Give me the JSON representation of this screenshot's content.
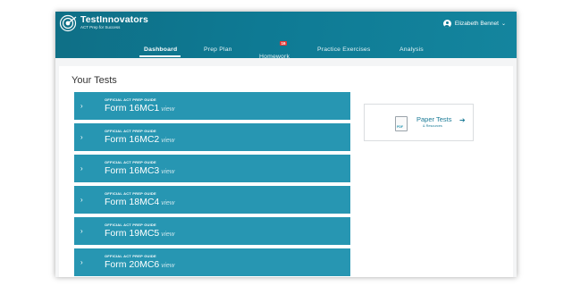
{
  "brand": {
    "name": "TestInnovators",
    "tagline": "ACT Prep for Success"
  },
  "user": {
    "name": "Elizabeth Bennet",
    "caret": "⌄"
  },
  "nav": {
    "items": [
      {
        "label": "Dashboard"
      },
      {
        "label": "Prep Plan"
      },
      {
        "label": "Homework",
        "badge": "16"
      },
      {
        "label": "Practice Exercises"
      },
      {
        "label": "Analysis"
      }
    ],
    "active": "Dashboard"
  },
  "main": {
    "section_title": "Your Tests",
    "tests": [
      {
        "label": "OFFICIAL ACT PREP GUIDE",
        "form": "Form 16MC1",
        "view": "view"
      },
      {
        "label": "OFFICIAL ACT PREP GUIDE",
        "form": "Form 16MC2",
        "view": "view"
      },
      {
        "label": "OFFICIAL ACT PREP GUIDE",
        "form": "Form 16MC3",
        "view": "view"
      },
      {
        "label": "OFFICIAL ACT PREP GUIDE",
        "form": "Form 18MC4",
        "view": "view"
      },
      {
        "label": "OFFICIAL ACT PREP GUIDE",
        "form": "Form 19MC5",
        "view": "view"
      },
      {
        "label": "OFFICIAL ACT PREP GUIDE",
        "form": "Form 20MC6",
        "view": "view"
      }
    ],
    "chevron": "›"
  },
  "paper_tests": {
    "title": "Paper Tests",
    "subtitle": "& Resources",
    "icon_text": "PDF",
    "arrow": "➔"
  },
  "colors": {
    "header": "#0e7a94",
    "test_row": "#2796b2",
    "badge": "#e53935"
  }
}
